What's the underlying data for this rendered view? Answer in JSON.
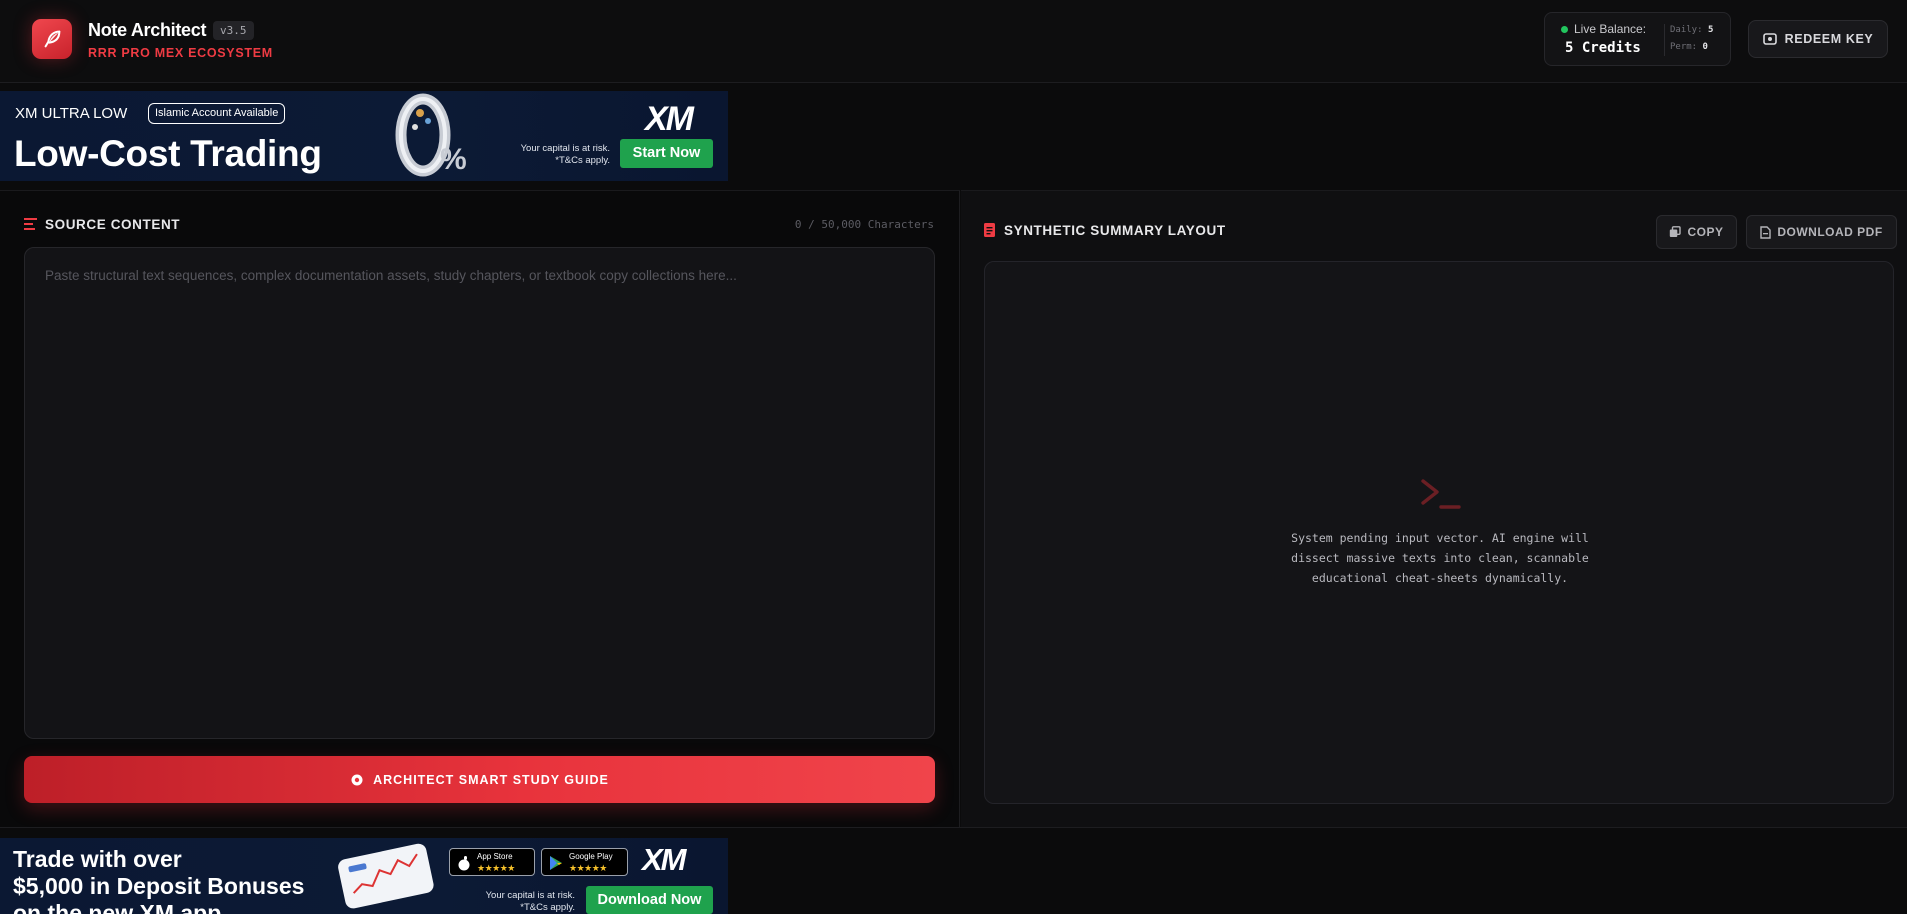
{
  "header": {
    "app_title": "Note Architect",
    "version": "v3.5",
    "subtitle": "RRR PRO MEX ECOSYSTEM",
    "balance_label": "Live Balance:",
    "balance_value": "5 Credits",
    "daily_label": "Daily:",
    "daily_value": "5",
    "perm_label": "Perm:",
    "perm_value": "0",
    "redeem_label": "REDEEM KEY"
  },
  "banner_top": {
    "small": "XM ULTRA LOW",
    "pill": "Islamic Account Available",
    "headline": "Low-Cost Trading",
    "brand": "XM",
    "risk_line1": "Your capital is at risk.",
    "risk_line2": "*T&Cs apply.",
    "cta": "Start Now"
  },
  "source": {
    "title": "SOURCE CONTENT",
    "char_count": "0 / 50,000 Characters",
    "placeholder": "Paste structural text sequences, complex documentation assets, study chapters, or textbook copy collections here...",
    "button_label": "ARCHITECT SMART STUDY GUIDE"
  },
  "summary": {
    "title": "SYNTHETIC SUMMARY LAYOUT",
    "copy_label": "COPY",
    "download_label": "DOWNLOAD PDF",
    "pending_line1": "System pending input vector. AI engine will",
    "pending_line2": "dissect massive texts into clean, scannable",
    "pending_line3": "educational cheat-sheets dynamically."
  },
  "banner_bottom": {
    "line1": "Trade with over",
    "line2": "$5,000 in Deposit Bonuses",
    "line3": "on the new XM app",
    "app_store": "App Store",
    "google_play": "Google Play",
    "stars": "★★★★★",
    "brand": "XM",
    "risk_line1": "Your capital is at risk.",
    "risk_line2": "*T&Cs apply.",
    "cta": "Download Now"
  },
  "colors": {
    "accent": "#ef3b43",
    "background": "#0b0b0c",
    "live_dot": "#22c55e",
    "ad_green": "#1fa24d"
  }
}
